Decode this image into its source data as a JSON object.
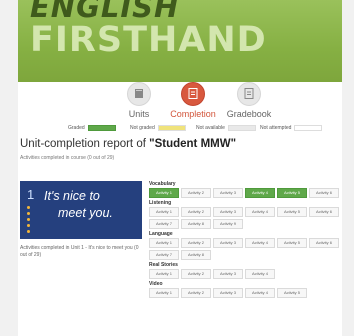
{
  "app": {
    "logo_line1": "ENGLISH",
    "logo_line2": "FIRSTHAND"
  },
  "nav": {
    "items": [
      {
        "label": "Units",
        "icon": "units-icon",
        "active": false
      },
      {
        "label": "Completion",
        "icon": "completion-icon",
        "active": true
      },
      {
        "label": "Gradebook",
        "icon": "gradebook-icon",
        "active": false
      }
    ]
  },
  "legend": {
    "graded": "Graded",
    "not_graded": "Not graded",
    "not_available": "Not available",
    "not_attempted": "Not attempted",
    "colors": {
      "graded": "#5fa84a",
      "not_graded": "#f0e37b",
      "not_available": "#e9e9e9",
      "not_attempted": "#ffffff"
    }
  },
  "report": {
    "title_prefix": "Unit-completion report of ",
    "student": "\"Student MMW\"",
    "subtitle": "Activities completed in course (0 out of 29)"
  },
  "unit": {
    "number": "1",
    "title_line1": "It's nice to",
    "title_line2": "meet you.",
    "note": "Activities completed in Unit 1 - It's nice to meet you (0 out of 29)"
  },
  "sections": [
    {
      "title": "Vocabulary",
      "activities": [
        {
          "label": "Activity 1",
          "status": "done"
        },
        {
          "label": "Activity 2",
          "status": "none"
        },
        {
          "label": "Activity 3",
          "status": "none"
        },
        {
          "label": "Activity 4",
          "status": "done"
        },
        {
          "label": "Activity 5",
          "status": "done"
        },
        {
          "label": "Activity 6",
          "status": "none"
        }
      ]
    },
    {
      "title": "Listening",
      "activities": [
        {
          "label": "Activity 1",
          "status": "none"
        },
        {
          "label": "Activity 2",
          "status": "none"
        },
        {
          "label": "Activity 3",
          "status": "none"
        },
        {
          "label": "Activity 4",
          "status": "none"
        },
        {
          "label": "Activity 5",
          "status": "none"
        },
        {
          "label": "Activity 6",
          "status": "none"
        },
        {
          "label": "Activity 7",
          "status": "none"
        },
        {
          "label": "Activity 8",
          "status": "none"
        },
        {
          "label": "Activity 9",
          "status": "none"
        }
      ]
    },
    {
      "title": "Language",
      "activities": [
        {
          "label": "Activity 1",
          "status": "none"
        },
        {
          "label": "Activity 2",
          "status": "none"
        },
        {
          "label": "Activity 3",
          "status": "none"
        },
        {
          "label": "Activity 4",
          "status": "none"
        },
        {
          "label": "Activity 5",
          "status": "none"
        },
        {
          "label": "Activity 6",
          "status": "none"
        },
        {
          "label": "Activity 7",
          "status": "none"
        },
        {
          "label": "Activity 8",
          "status": "none"
        }
      ]
    },
    {
      "title": "Real Stories",
      "activities": [
        {
          "label": "Activity 1",
          "status": "none"
        },
        {
          "label": "Activity 2",
          "status": "none"
        },
        {
          "label": "Activity 3",
          "status": "none"
        },
        {
          "label": "Activity 4",
          "status": "none"
        }
      ]
    },
    {
      "title": "Video",
      "activities": [
        {
          "label": "Activity 1",
          "status": "none"
        },
        {
          "label": "Activity 2",
          "status": "none"
        },
        {
          "label": "Activity 3",
          "status": "none"
        },
        {
          "label": "Activity 4",
          "status": "none"
        },
        {
          "label": "Activity 5",
          "status": "none"
        }
      ]
    }
  ]
}
